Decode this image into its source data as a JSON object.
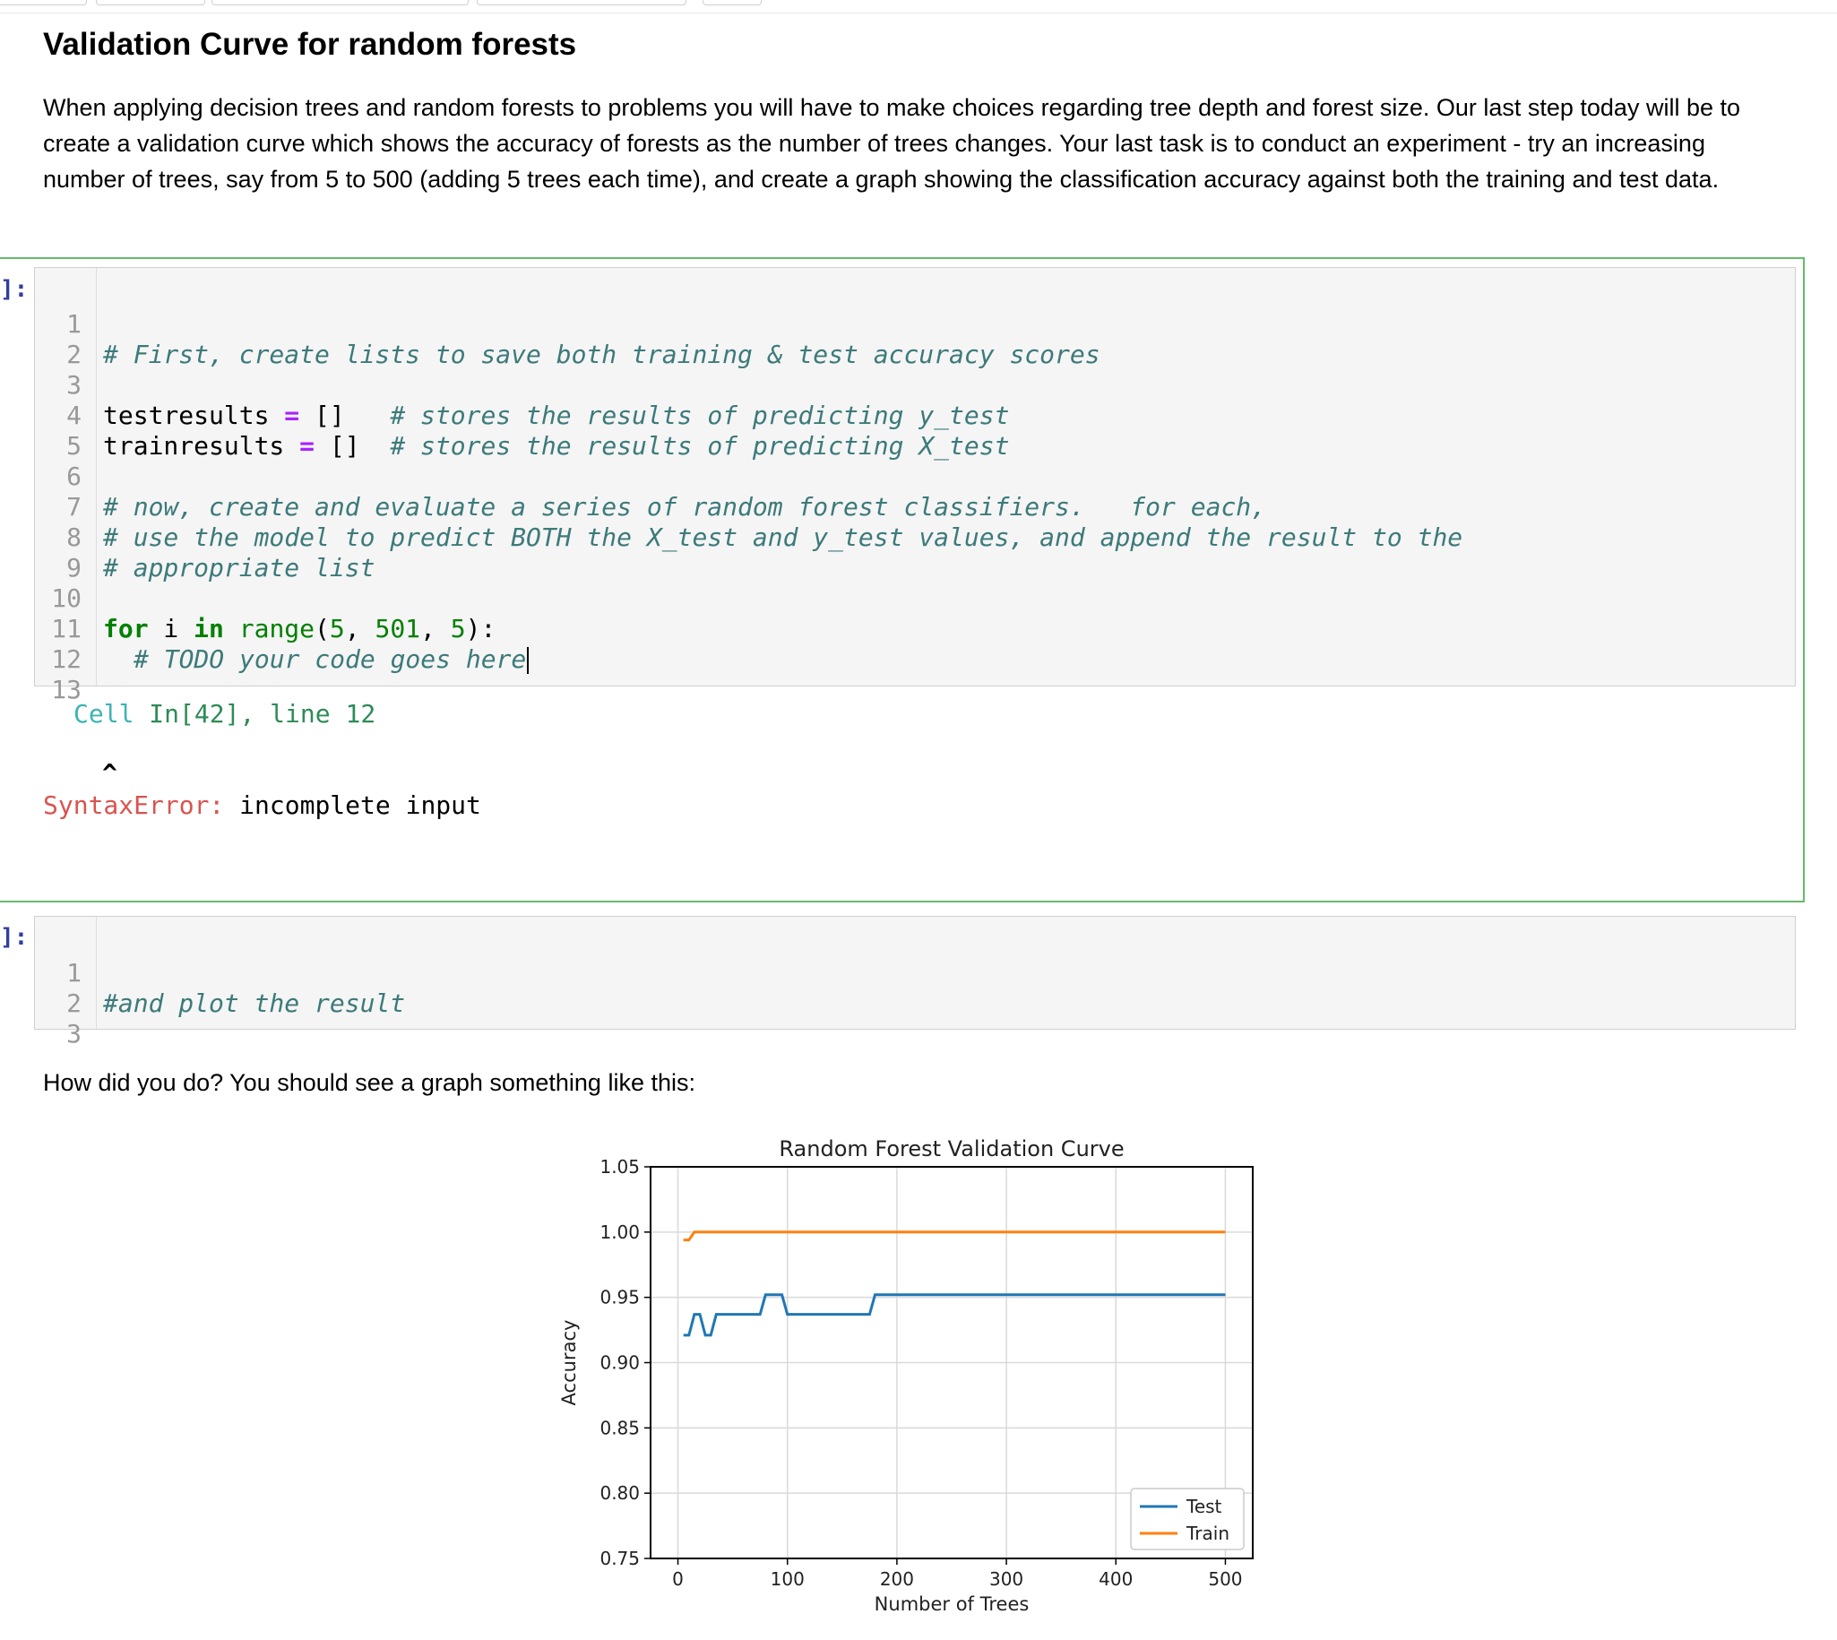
{
  "markdown_top": {
    "heading": "Validation Curve for random forests",
    "paragraph": "When applying decision trees and random forests to problems you will have to make choices regarding tree depth and forest size. Our last step today will be to create a validation curve which shows the accuracy of forests as the number of trees changes. Your last task is to conduct an experiment - try an increasing number of trees, say from 5 to 500 (adding 5 trees each time), and create a graph showing the classification accuracy against both the training and test data."
  },
  "cell1": {
    "prompt": "]:",
    "line_numbers": [
      "1",
      "2",
      "3",
      "4",
      "5",
      "6",
      "7",
      "8",
      "9",
      "10",
      "11",
      "12",
      "13"
    ],
    "code": {
      "l1": "# First, create lists to save both training & test accuracy scores",
      "l3_var": "testresults ",
      "l3_op": "=",
      "l3_val": " []   ",
      "l3_comment": "# stores the results of predicting y_test",
      "l4_var": "trainresults ",
      "l4_op": "=",
      "l4_val": " []  ",
      "l4_comment": "# stores the results of predicting X_test",
      "l6": "# now, create and evaluate a series of random forest classifiers.   for each,",
      "l7": "# use the model to predict BOTH the X_test and y_test values, and append the result to the",
      "l8": "# appropriate list",
      "l10_for": "for",
      "l10_i": " i ",
      "l10_in": "in",
      "l10_sp": " ",
      "l10_range": "range",
      "l10_p1": "(",
      "l10_n1": "5",
      "l10_c1": ", ",
      "l10_n2": "501",
      "l10_c2": ", ",
      "l10_n3": "5",
      "l10_end": "):",
      "l11": "# TODO your code goes here"
    },
    "traceback": {
      "cell": "Cell",
      "in": "In[42]",
      "line": ", line 12",
      "caret": "^",
      "error_name": "SyntaxError:",
      "error_msg": " incomplete input"
    }
  },
  "cell2": {
    "prompt": "]:",
    "line_numbers": [
      "1",
      "2",
      "3"
    ],
    "l1": "#and plot the result"
  },
  "markdown_bottom": {
    "text": "How did you do? You should see a graph something like this:"
  },
  "chart_data": {
    "type": "line",
    "title": "Random Forest Validation Curve",
    "xlabel": "Number of Trees",
    "ylabel": "Accuracy",
    "xlim": [
      -25,
      525
    ],
    "ylim": [
      0.75,
      1.05
    ],
    "xticks": [
      "0",
      "100",
      "200",
      "300",
      "400",
      "500"
    ],
    "yticks": [
      "0.75",
      "0.80",
      "0.85",
      "0.90",
      "0.95",
      "1.00",
      "1.05"
    ],
    "grid": true,
    "legend_position": "lower-right",
    "series": [
      {
        "name": "Test",
        "color": "#1f77b4",
        "x": [
          5,
          10,
          15,
          20,
          25,
          30,
          35,
          40,
          75,
          80,
          95,
          100,
          175,
          180,
          500
        ],
        "y": [
          0.921,
          0.921,
          0.937,
          0.937,
          0.921,
          0.921,
          0.937,
          0.937,
          0.937,
          0.952,
          0.952,
          0.937,
          0.937,
          0.952,
          0.952
        ]
      },
      {
        "name": "Train",
        "color": "#ff7f0e",
        "x": [
          5,
          10,
          15,
          500
        ],
        "y": [
          0.994,
          0.994,
          1.0,
          1.0
        ]
      }
    ]
  }
}
